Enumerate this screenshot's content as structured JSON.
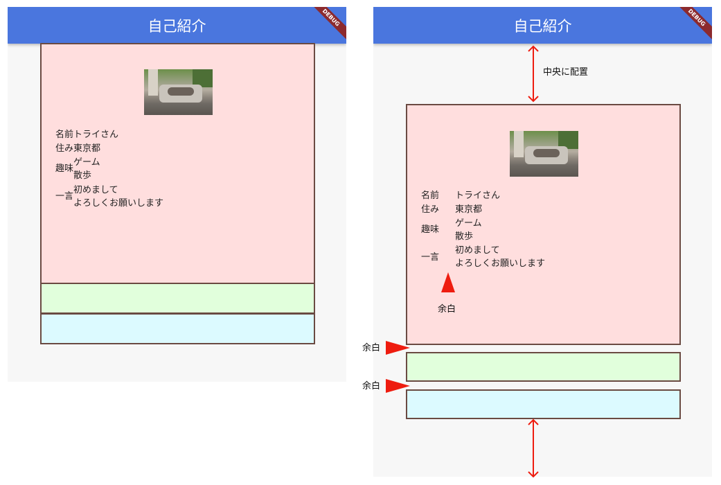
{
  "app_title": "自己紹介",
  "debug_label": "DEBUG",
  "profile": {
    "name_label": "名前",
    "name_value": "トライさん",
    "home_label": "住み",
    "home_value": "東京都",
    "hobby_label": "趣味",
    "hobby_values": [
      "ゲーム",
      "散歩"
    ],
    "comment_label": "一言",
    "comment_values": [
      "初めまして",
      "よろしくお願いします"
    ]
  },
  "annotations": {
    "center": "中央に配置",
    "margin": "余白"
  },
  "colors": {
    "appbar": "#4a76de",
    "profile_box": "#ffdede",
    "green_box": "#e1ffdc",
    "cyan_box": "#dcfaff",
    "border": "#6a4a42",
    "arrow": "#ee1c0f",
    "background": "#f7f7f7"
  },
  "icons": [
    "cat-photo",
    "debug-ribbon",
    "double-arrow-icon",
    "red-pointer-icon"
  ]
}
